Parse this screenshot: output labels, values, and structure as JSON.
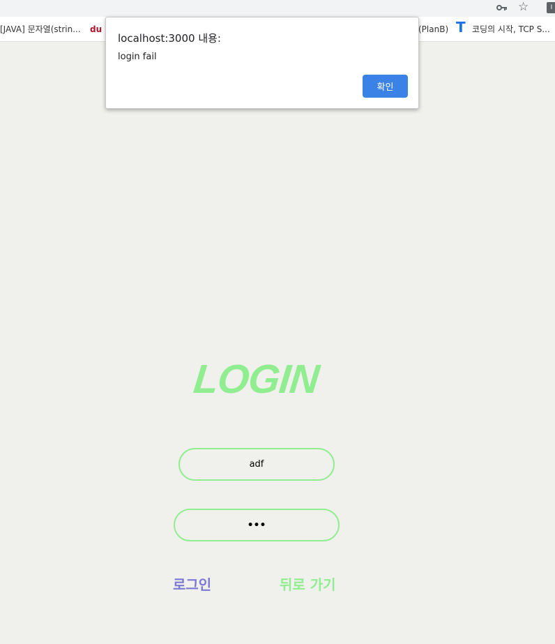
{
  "browser": {
    "bookmarks": [
      {
        "label": "[JAVA] 문자열(strin..."
      },
      {
        "label": "du"
      },
      {
        "label": "(PlanB)"
      },
      {
        "label": "T"
      },
      {
        "label": "코딩의 시작, TCP S..."
      }
    ],
    "toolbar_icons": [
      "key-icon",
      "star-icon",
      "extension-icon"
    ]
  },
  "dialog": {
    "title": "localhost:3000 내용:",
    "message": "login fail",
    "ok_label": "확인"
  },
  "login": {
    "title": "LOGIN",
    "id_value": "adf",
    "password_value": "•••",
    "login_label": "로그인",
    "back_label": "뒤로 가기",
    "colors": {
      "accent_green": "#90ee90",
      "login_purple": "#7b79d6",
      "dialog_button": "#3b82e6",
      "background": "#f0f0ec"
    }
  }
}
